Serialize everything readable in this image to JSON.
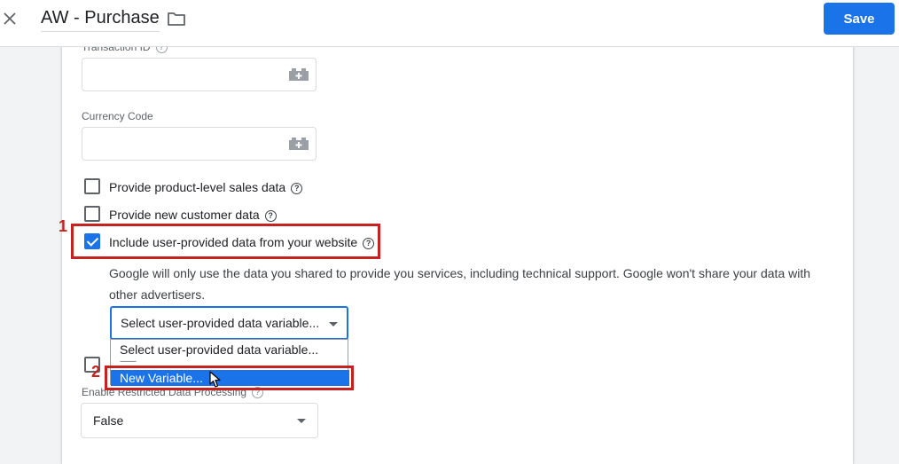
{
  "header": {
    "title": "AW - Purchase",
    "save_label": "Save",
    "close_icon": "close-icon",
    "folder_icon": "folder-icon"
  },
  "colors": {
    "primary": "#1a73e8",
    "annotation": "#c5221f"
  },
  "form": {
    "transaction_id_label": "Transaction ID",
    "transaction_id_value": "",
    "currency_code_label": "Currency Code",
    "currency_code_value": "",
    "checkboxes": [
      {
        "label": "Provide product-level sales data",
        "checked": false
      },
      {
        "label": "Provide new customer data",
        "checked": false
      },
      {
        "label": "Include user-provided data from your website",
        "checked": true
      }
    ],
    "info_text": "Google will only use the data you shared to provide you services, including technical support. Google won't share your data with other advertisers.",
    "user_data_select": {
      "selected": "Select user-provided data variable...",
      "options": [
        "Select user-provided data variable...",
        "---------",
        "New Variable..."
      ]
    },
    "restricted_label": "Enable Restricted Data Processing",
    "restricted_value": "False"
  },
  "annotations": [
    "1",
    "2"
  ]
}
